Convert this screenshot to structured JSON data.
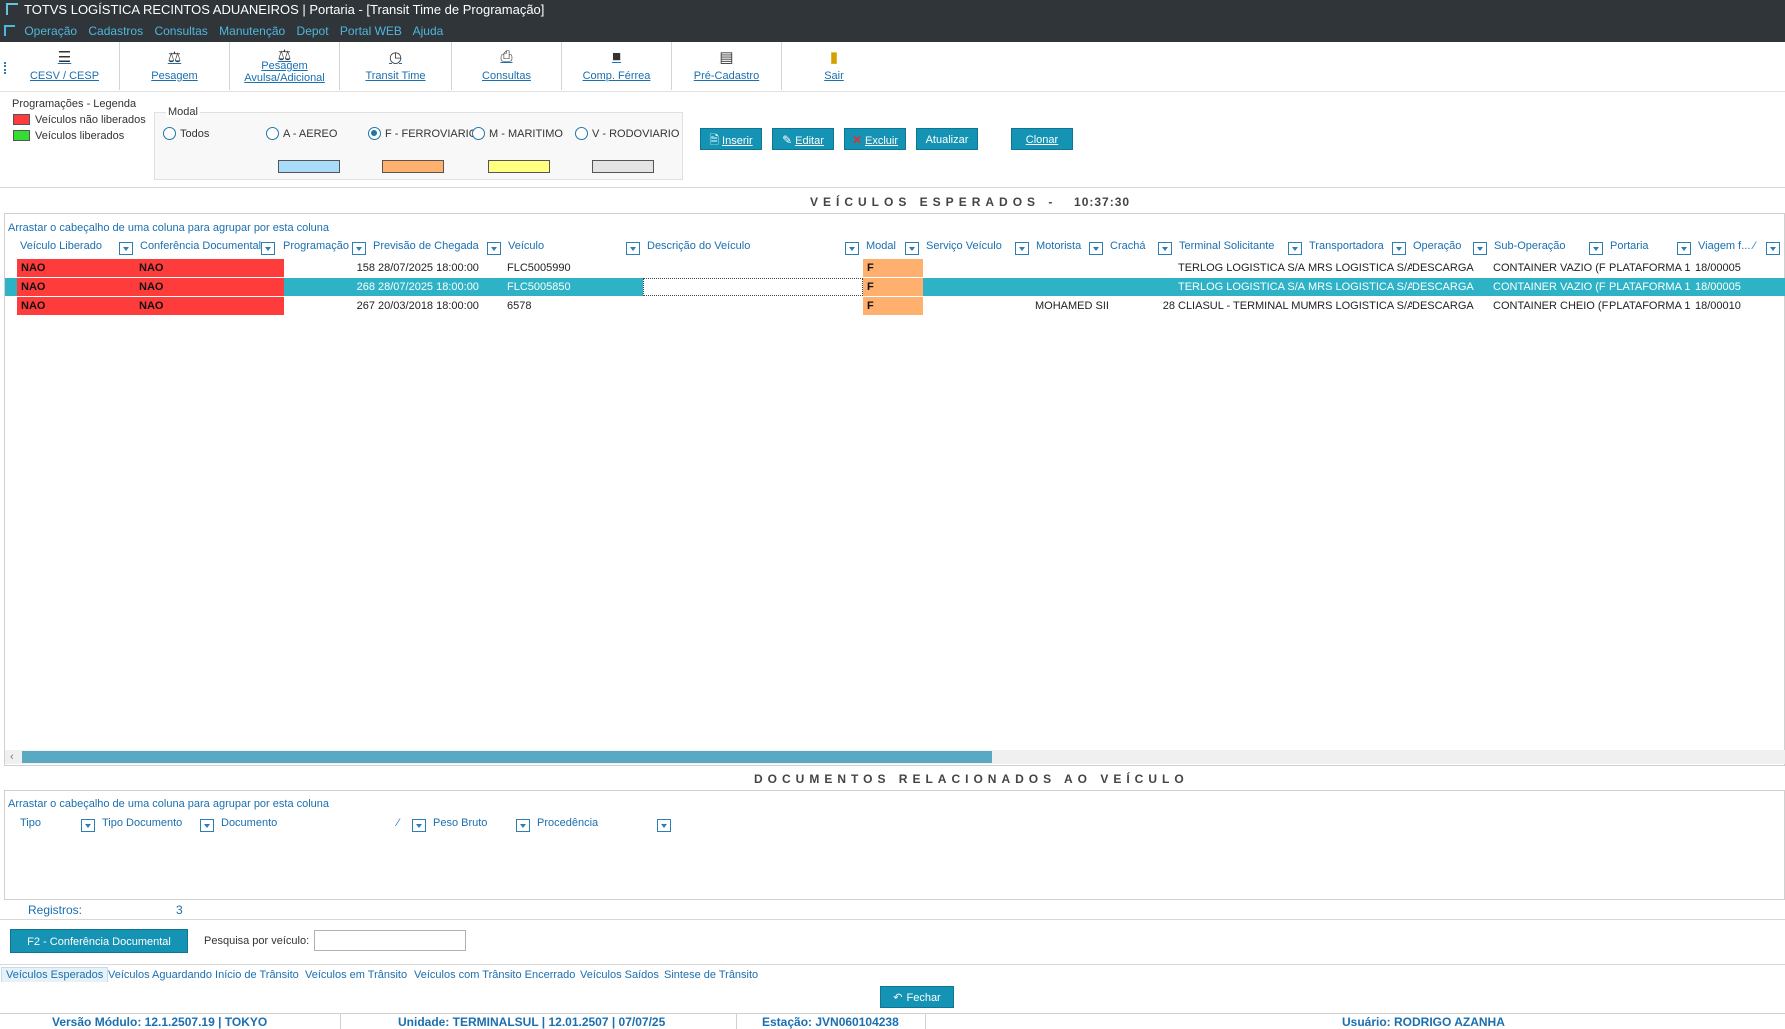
{
  "window": {
    "title": "TOTVS LOGÍSTICA RECINTOS ADUANEIROS | Portaria - [Transit Time de Programação]"
  },
  "menu": [
    "Operação",
    "Cadastros",
    "Consultas",
    "Manutenção",
    "Depot",
    "Portal WEB",
    "Ajuda"
  ],
  "toolbar": [
    {
      "label": "CESV / CESP",
      "icon": "traffic-light-icon"
    },
    {
      "label": "Pesagem",
      "icon": "scale-icon"
    },
    {
      "label": "Pesagem Avulsa/Adicional",
      "icon": "scale-extra-icon"
    },
    {
      "label": "Transit Time",
      "icon": "clock-icon"
    },
    {
      "label": "Consultas",
      "icon": "printer-icon"
    },
    {
      "label": "Comp. Férrea",
      "icon": "train-icon"
    },
    {
      "label": "Pré-Cadastro",
      "icon": "register-icon"
    },
    {
      "label": "Sair",
      "icon": "exit-door-icon"
    }
  ],
  "legend": {
    "title": "Programações - Legenda",
    "items": [
      {
        "label": "Veículos não liberados",
        "color": "#ff3c3c"
      },
      {
        "label": "Veículos liberados",
        "color": "#33dd33"
      }
    ]
  },
  "modal": {
    "title": "Modal",
    "options": [
      {
        "label": "Todos",
        "selected": false
      },
      {
        "label": "A - AEREO",
        "selected": false,
        "color": "#a8dcf8"
      },
      {
        "label": "F - FERROVIARIO",
        "selected": true,
        "color": "#ffaf6e"
      },
      {
        "label": "M - MARITIMO",
        "selected": false,
        "color": "#ffff80"
      },
      {
        "label": "V - RODOVIARIO",
        "selected": false,
        "color": "#e4e4e4"
      }
    ]
  },
  "actions": {
    "inserir": "Inserir",
    "editar": "Editar",
    "excluir": "Excluir",
    "atualizar": "Atualizar",
    "clonar": "Clonar"
  },
  "main_section": {
    "title": "VEÍCULOS ESPERADOS -",
    "time": "10:37:30"
  },
  "grid": {
    "group_hint": "Arrastar o cabeçalho de uma coluna para agrupar por esta coluna",
    "columns": [
      "Veículo Liberado",
      "Conferência Documental",
      "Programação",
      "Previsão de Chegada",
      "Veículo",
      "Descrição do Veículo",
      "Modal",
      "Serviço Veículo",
      "Motorista",
      "Crachá",
      "Terminal Solicitante",
      "Transportadora",
      "Operação",
      "Sub-Operação",
      "Portaria",
      "Viagem f..."
    ],
    "rows": [
      {
        "liberado": "NAO",
        "conferencia": "NAO",
        "programacao": "158",
        "previsao": "28/07/2025 18:00:00",
        "veiculo": "FLC5005990",
        "descricao": "",
        "modal": "F",
        "servico": "",
        "motorista": "",
        "cracha": "",
        "terminal": "TERLOG LOGISTICA S/A",
        "transportadora": "MRS LOGISTICA S/A",
        "operacao": "DESCARGA",
        "suboperacao": "CONTAINER VAZIO (F",
        "portaria": "PLATAFORMA 1",
        "viagem": "18/00005",
        "selected": false
      },
      {
        "liberado": "NAO",
        "conferencia": "NAO",
        "programacao": "268",
        "previsao": "28/07/2025 18:00:00",
        "veiculo": "FLC5005850",
        "descricao": "",
        "modal": "F",
        "servico": "",
        "motorista": "",
        "cracha": "",
        "terminal": "TERLOG LOGISTICA S/A",
        "transportadora": "MRS LOGISTICA S/A",
        "operacao": "DESCARGA",
        "suboperacao": "CONTAINER VAZIO (F",
        "portaria": "PLATAFORMA 1",
        "viagem": "18/00005",
        "selected": true
      },
      {
        "liberado": "NAO",
        "conferencia": "NAO",
        "programacao": "267",
        "previsao": "20/03/2018 18:00:00",
        "veiculo": "6578",
        "descricao": "",
        "modal": "F",
        "servico": "",
        "motorista": "MOHAMED SII",
        "cracha": "28",
        "terminal": "CLIASUL - TERMINAL MU",
        "transportadora": "MRS LOGISTICA S/A",
        "operacao": "DESCARGA",
        "suboperacao": "CONTAINER CHEIO (F",
        "portaria": "PLATAFORMA 1",
        "viagem": "18/00010",
        "selected": false
      }
    ]
  },
  "doc_section": {
    "title": "DOCUMENTOS RELACIONADOS AO VEÍCULO"
  },
  "doc_grid": {
    "group_hint": "Arrastar o cabeçalho de uma coluna para agrupar por esta coluna",
    "columns": [
      "Tipo",
      "Tipo Documento",
      "Documento",
      "Peso Bruto",
      "Procedência"
    ]
  },
  "registros": {
    "label": "Registros:",
    "value": "3"
  },
  "f2_button": "F2 - Conferência Documental",
  "pesquisa": {
    "label": "Pesquisa  por veículo:",
    "value": ""
  },
  "tabs": [
    "Veículos Esperados",
    "Veículos Aguardando Início de Trânsito",
    "Veículos em Trânsito",
    "Veículos com Trânsito Encerrado",
    "Veículos Saídos",
    "Sintese de Trânsito"
  ],
  "fechar": "Fechar",
  "status": {
    "versao": "Versão Módulo:   12.1.2507.19  |  TOKYO",
    "unidade": "Unidade:  TERMINALSUL | 12.01.2507 | 07/07/25",
    "estacao": "Estação:  JVN060104238",
    "usuario": "Usuário:  RODRIGO AZANHA"
  }
}
